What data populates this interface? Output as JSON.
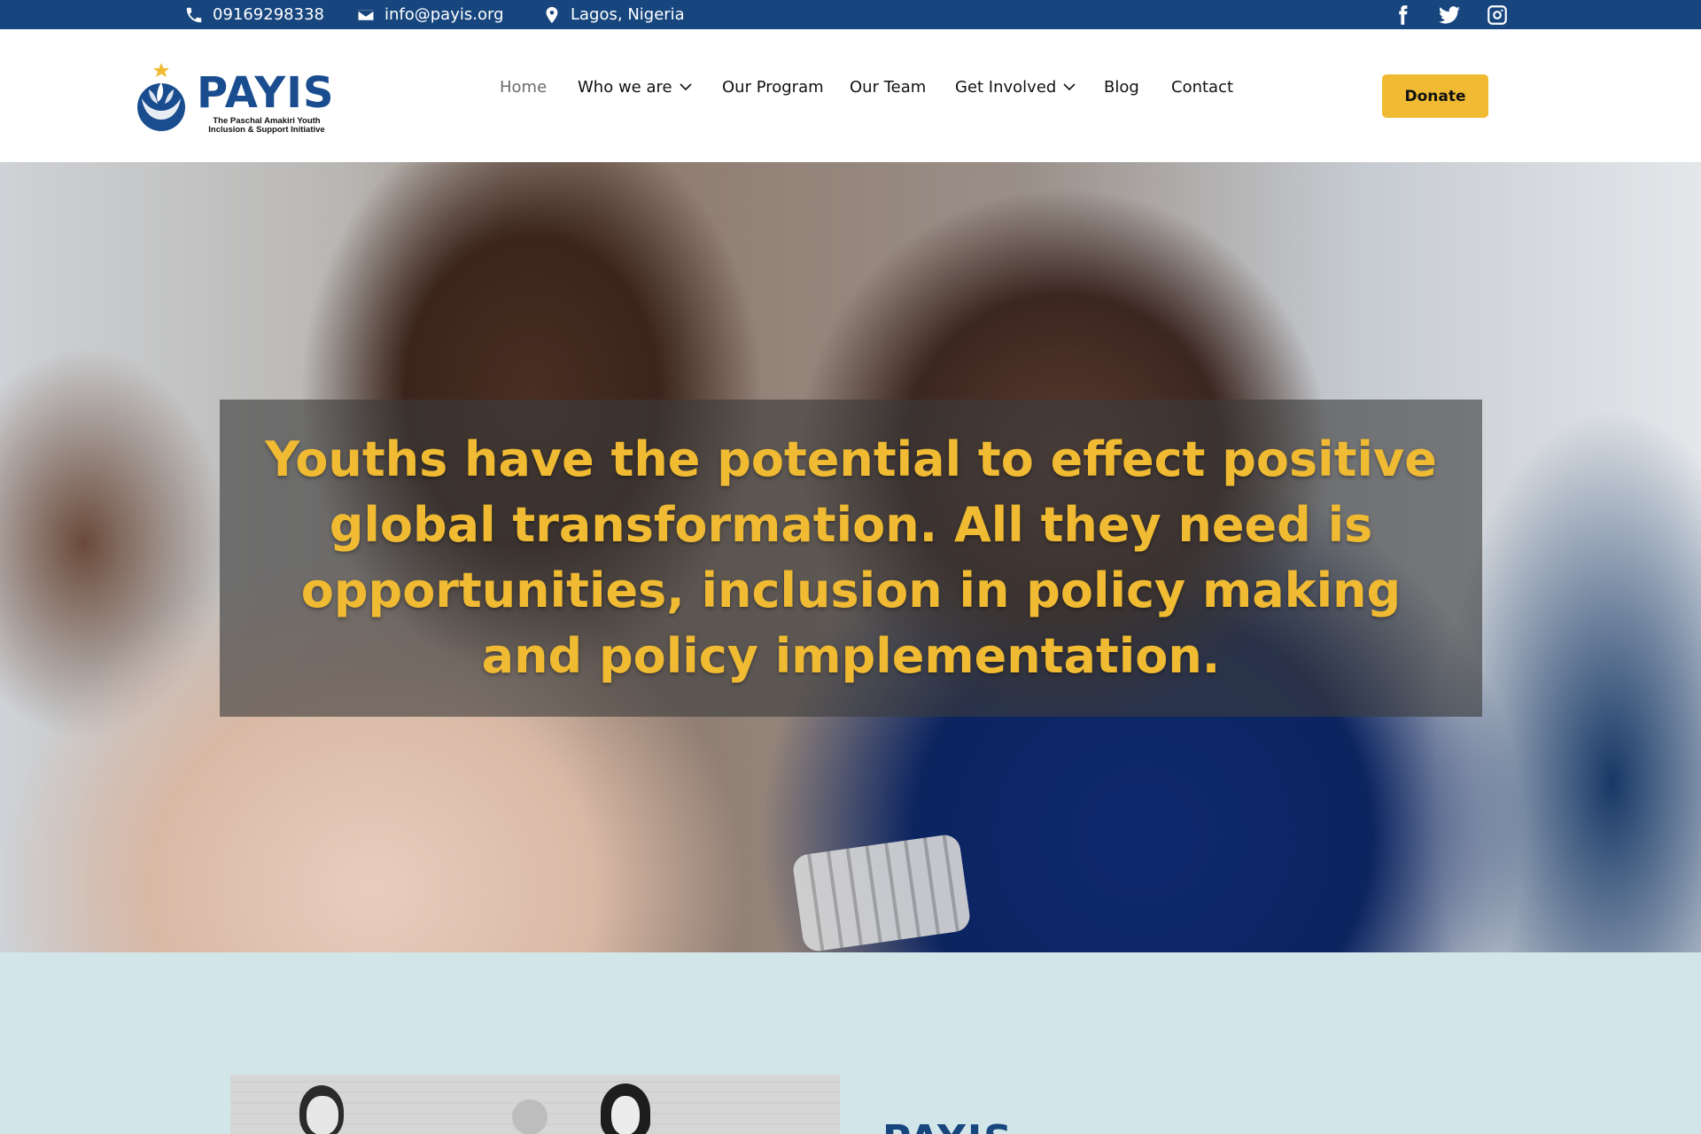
{
  "topbar": {
    "phone": "09169298338",
    "email": "info@payis.org",
    "location": "Lagos, Nigeria",
    "social": [
      "facebook-icon",
      "twitter-icon",
      "instagram-icon"
    ],
    "background": "#17467f"
  },
  "header": {
    "logo": {
      "wordmark": "PAYIS",
      "tagline": "The Paschal Amakiri Youth Inclusion & Support Initiative"
    },
    "nav": [
      {
        "label": "Home",
        "active": true
      },
      {
        "label": "Who we are",
        "dropdown": true
      },
      {
        "label": "Our Program"
      },
      {
        "label": "Our Team"
      },
      {
        "label": "Get Involved",
        "dropdown": true
      },
      {
        "label": "Blog"
      },
      {
        "label": "Contact"
      }
    ],
    "donate_label": "Donate"
  },
  "hero": {
    "quote": "Youths have the potential to effect positive global transformation. All they need is opportunities, inclusion in policy making and policy implementation."
  },
  "about": {
    "heading": "PAYIS"
  },
  "colors": {
    "brand_blue": "#17467f",
    "accent_yellow": "#f0bb32",
    "section_bg": "#d2e5e9"
  }
}
